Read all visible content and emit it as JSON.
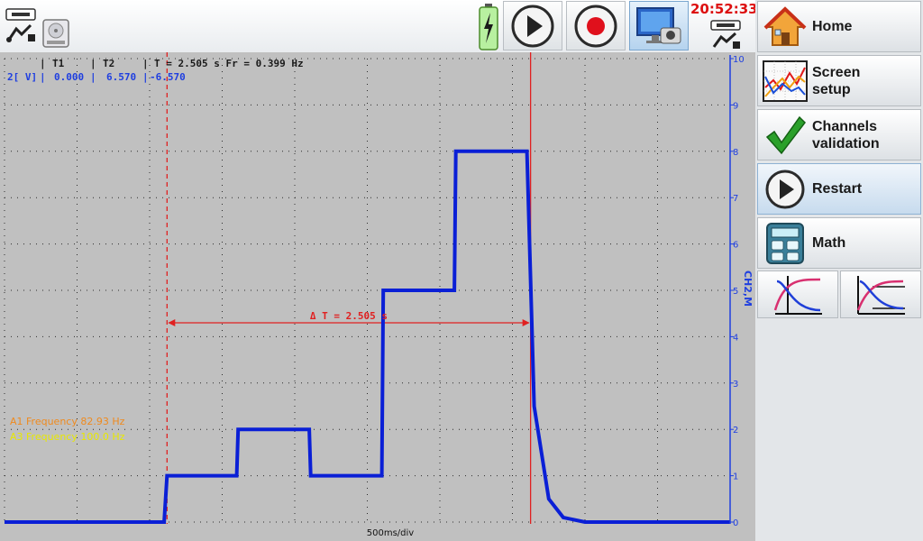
{
  "clock": "20:52:33",
  "toolbar": {
    "icons": [
      "usb-icon",
      "disk-icon",
      "battery-icon",
      "play-icon",
      "record-icon",
      "screenshot-icon",
      "usb-icon"
    ]
  },
  "cursors": {
    "header_t1": "T1",
    "header_t2": "T2",
    "header_dt": "T = 2.505 s Fr =  0.399 Hz",
    "channel": "2[ V]",
    "t1_value": "0.000",
    "t2_value": "6.570",
    "diff_value": "-6.570",
    "delta_label": "Δ T = 2.505 s"
  },
  "measurements": [
    {
      "text": "A1 Frequency 82.93 Hz",
      "color": "#ef8a1e"
    },
    {
      "text": "A3 Frequency 100.0 Hz",
      "color": "#e8e800"
    }
  ],
  "axis": {
    "channel_label": "CH2,M",
    "ticks": [
      "10",
      "9",
      "8",
      "7",
      "6",
      "5",
      "4",
      "3",
      "2",
      "1",
      "0"
    ],
    "timebase": "500ms/div"
  },
  "colors": {
    "trace": "#0a1fd6",
    "cursor": "#e02020",
    "axis": "#1f3fe0",
    "grid_bg": "#c0c0c0"
  },
  "chart_data": {
    "type": "line",
    "title": "",
    "xlabel": "500ms/div",
    "ylabel": "CH2,M",
    "x_unit": "s",
    "ylim": [
      0,
      10
    ],
    "xlim": [
      0,
      5
    ],
    "series": [
      {
        "x": [
          0,
          1.1,
          1.12,
          1.6,
          1.61,
          2.1,
          2.11,
          2.6,
          2.61,
          3.1,
          3.11,
          3.6,
          3.65,
          3.75,
          3.85,
          4.0,
          5.0
        ],
        "y": [
          0,
          0,
          1,
          1,
          2,
          2,
          1,
          1,
          5,
          5,
          8,
          8,
          2.5,
          0.5,
          0.1,
          0,
          0
        ]
      }
    ],
    "cursors": {
      "t1": 1.12,
      "t2": 3.625
    }
  },
  "sidebar": {
    "home_label": "Home",
    "screen_setup_label": "Screen\nsetup",
    "channels_validation_label": "Channels\nvalidation",
    "restart_label": "Restart",
    "math_label": "Math"
  }
}
